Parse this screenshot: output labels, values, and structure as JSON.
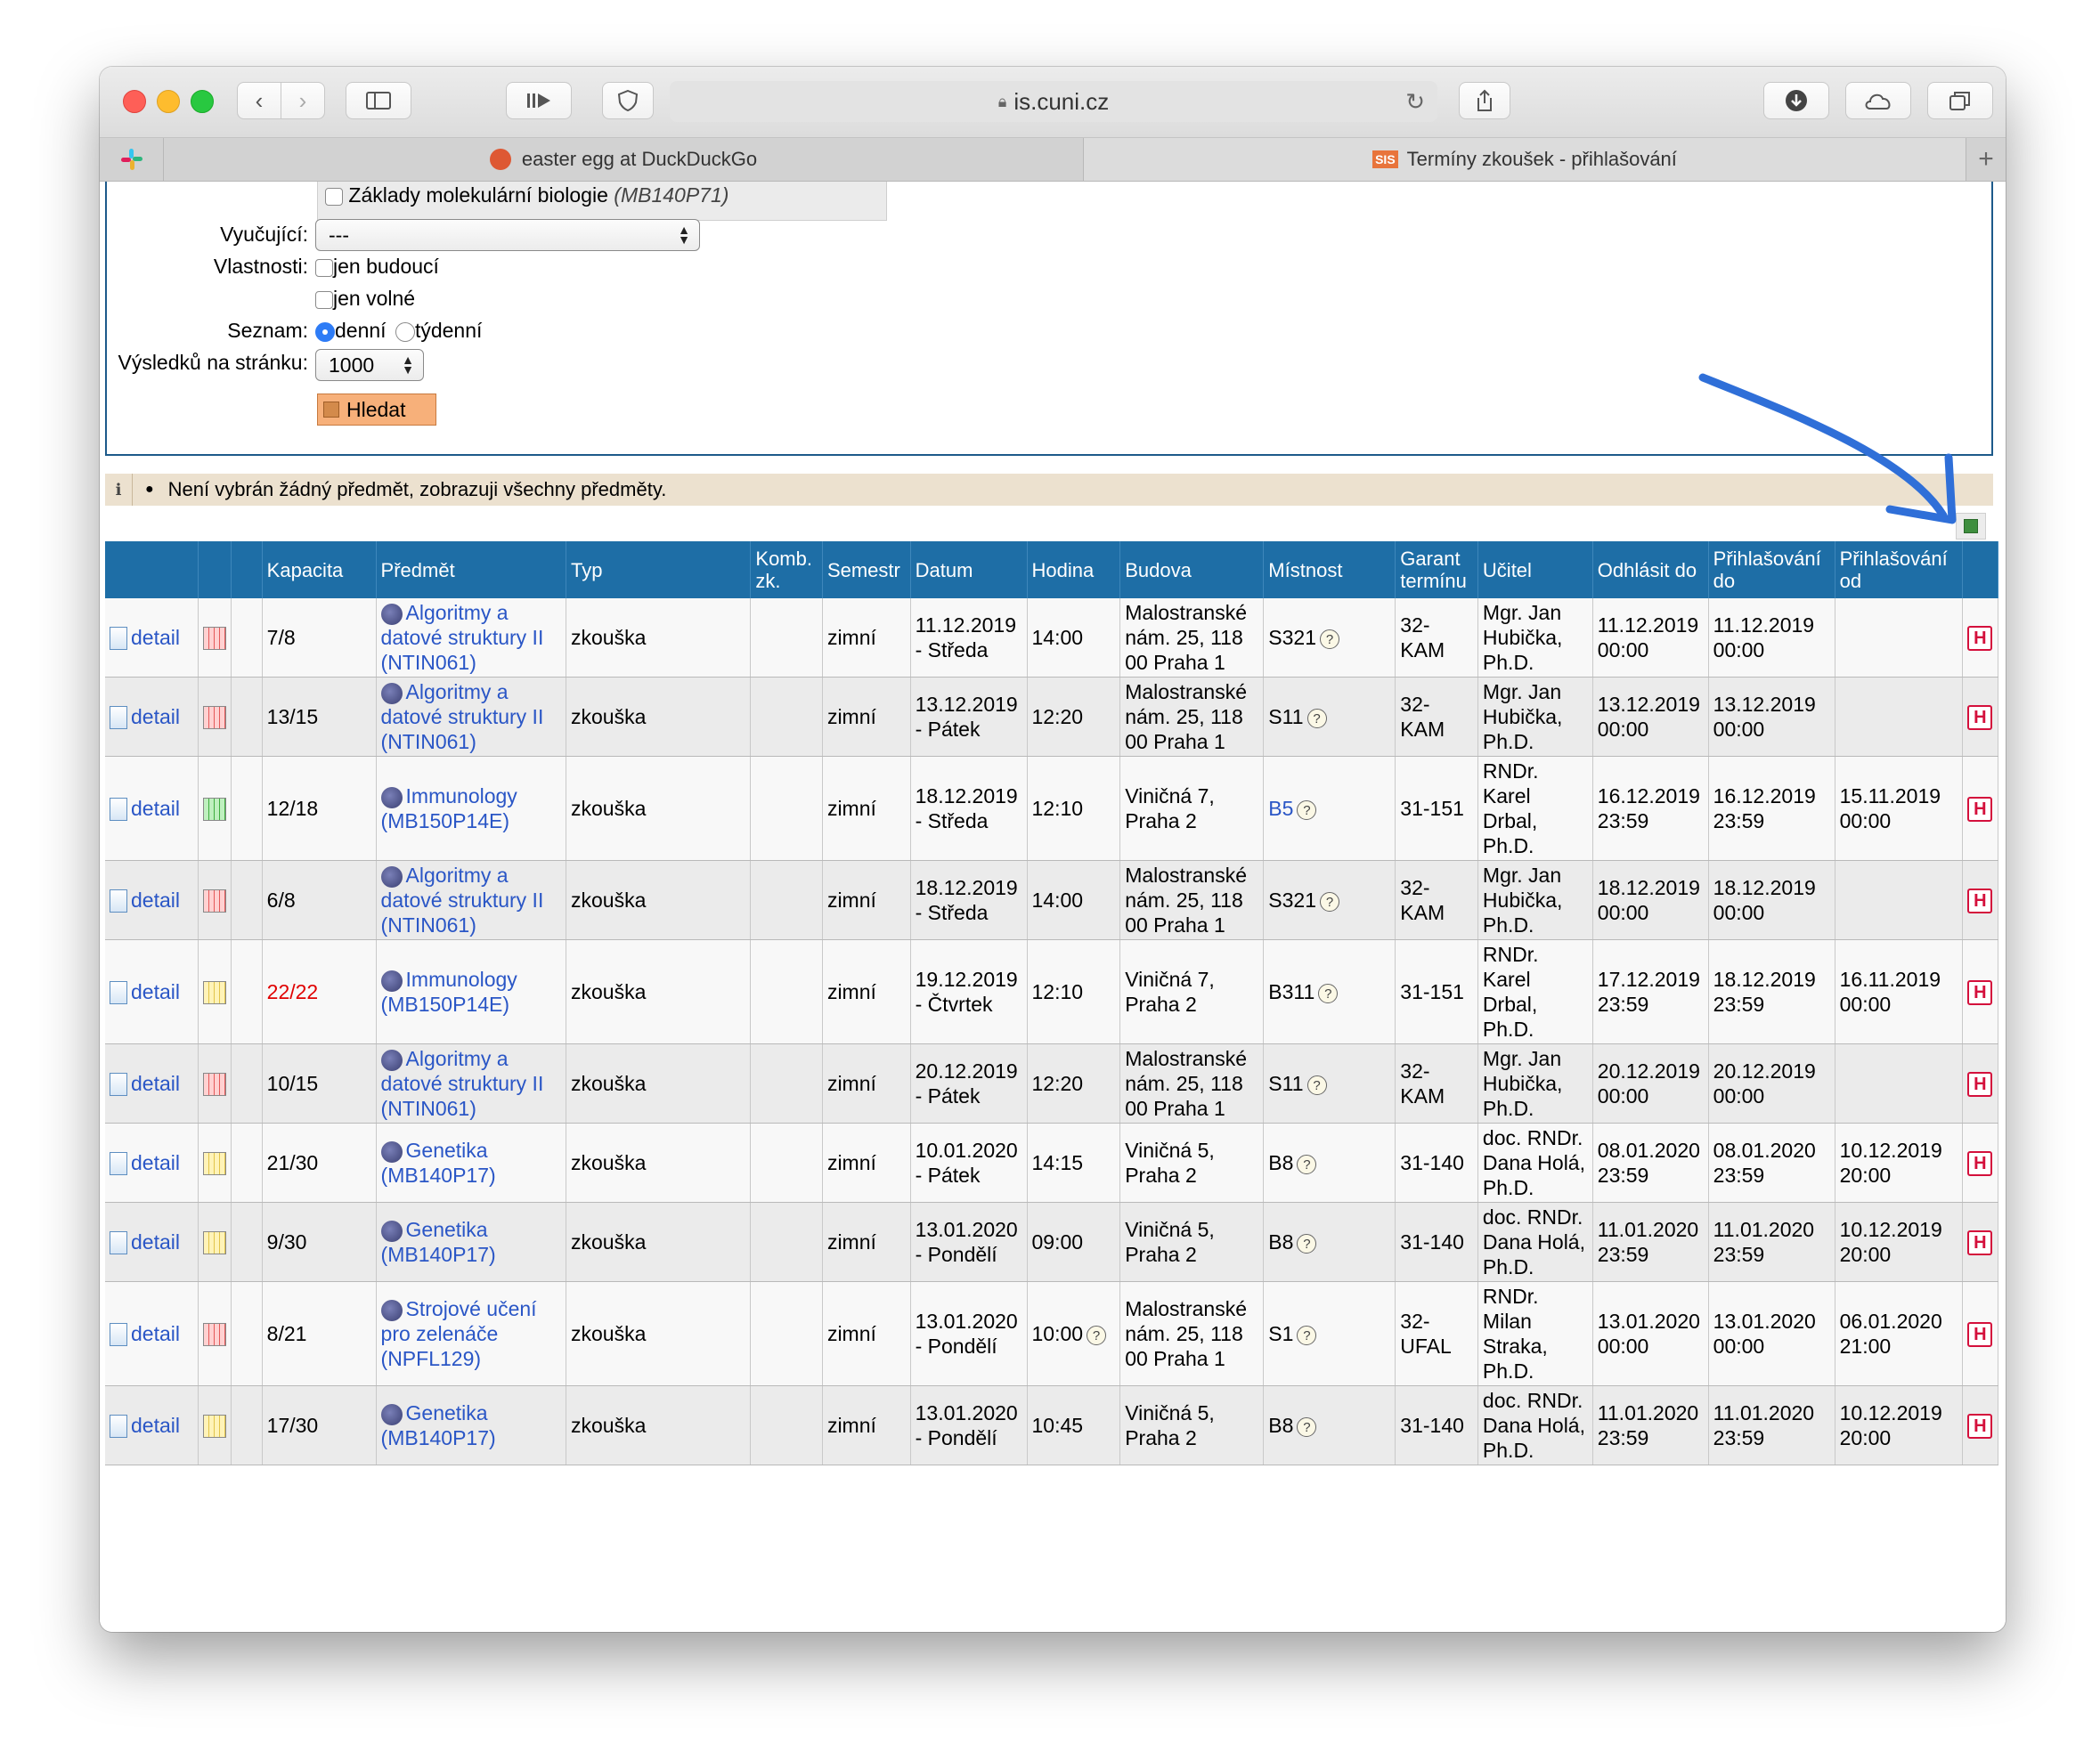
{
  "browser": {
    "url": "is.cuni.cz",
    "tabs": [
      {
        "title": "easter egg at DuckDuckGo"
      },
      {
        "title": "Termíny zkoušek - přihlašování",
        "badge": "SIS"
      }
    ]
  },
  "form": {
    "course_option": "Základy molekulární biologie",
    "course_option_code": "(MB140P71)",
    "teacher_label": "Vyučující:",
    "teacher_value": "---",
    "props_label": "Vlastnosti:",
    "prop_future": "jen budoucí",
    "prop_free": "jen volné",
    "list_label": "Seznam:",
    "list_daily": "denní",
    "list_weekly": "týdenní",
    "per_page_label": "Výsledků na stránku:",
    "per_page_value": "1000",
    "search_button": "Hledat"
  },
  "notice": {
    "bullet": "●",
    "text": "Není vybrán žádný předmět, zobrazuji všechny předměty."
  },
  "table": {
    "headers": {
      "kapacita": "Kapacita",
      "predmet": "Předmět",
      "typ": "Typ",
      "komb": "Komb. zk.",
      "semestr": "Semestr",
      "datum": "Datum",
      "hodina": "Hodina",
      "budova": "Budova",
      "mistnost": "Místnost",
      "garant": "Garant termínu",
      "ucitel": "Učitel",
      "odhlasit": "Odhlásit do",
      "prihl_do": "Přihlašování do",
      "prihl_od": "Přihlašování od"
    },
    "detail_label": "detail",
    "rows": [
      {
        "kapacita": "7/8",
        "full": false,
        "cal": "red",
        "predmet": "Algoritmy a datové struktury II (NTIN061)",
        "typ": "zkouška",
        "semestr": "zimní",
        "datum": "11.12.2019 - Středa",
        "hodina": "14:00",
        "budova": "Malostranské nám. 25, 118 00 Praha 1",
        "mistnost": "S321",
        "mistnost_link": false,
        "garant": "32-KAM",
        "ucitel": "Mgr. Jan Hubička, Ph.D.",
        "odhlasit": "11.12.2019 00:00",
        "prihl_do": "11.12.2019 00:00",
        "prihl_od": ""
      },
      {
        "kapacita": "13/15",
        "full": false,
        "cal": "red",
        "predmet": "Algoritmy a datové struktury II (NTIN061)",
        "typ": "zkouška",
        "semestr": "zimní",
        "datum": "13.12.2019 - Pátek",
        "hodina": "12:20",
        "budova": "Malostranské nám. 25, 118 00 Praha 1",
        "mistnost": "S11",
        "mistnost_link": false,
        "garant": "32-KAM",
        "ucitel": "Mgr. Jan Hubička, Ph.D.",
        "odhlasit": "13.12.2019 00:00",
        "prihl_do": "13.12.2019 00:00",
        "prihl_od": ""
      },
      {
        "kapacita": "12/18",
        "full": false,
        "cal": "green",
        "predmet": "Immunology (MB150P14E)",
        "typ": "zkouška",
        "semestr": "zimní",
        "datum": "18.12.2019 - Středa",
        "hodina": "12:10",
        "budova": "Viničná 7, Praha 2",
        "mistnost": "B5",
        "mistnost_link": true,
        "garant": "31-151",
        "ucitel": "RNDr. Karel Drbal, Ph.D.",
        "odhlasit": "16.12.2019 23:59",
        "prihl_do": "16.12.2019 23:59",
        "prihl_od": "15.11.2019 00:00"
      },
      {
        "kapacita": "6/8",
        "full": false,
        "cal": "red",
        "predmet": "Algoritmy a datové struktury II (NTIN061)",
        "typ": "zkouška",
        "semestr": "zimní",
        "datum": "18.12.2019 - Středa",
        "hodina": "14:00",
        "budova": "Malostranské nám. 25, 118 00 Praha 1",
        "mistnost": "S321",
        "mistnost_link": false,
        "garant": "32-KAM",
        "ucitel": "Mgr. Jan Hubička, Ph.D.",
        "odhlasit": "18.12.2019 00:00",
        "prihl_do": "18.12.2019 00:00",
        "prihl_od": ""
      },
      {
        "kapacita": "22/22",
        "full": true,
        "cal": "yellow",
        "predmet": "Immunology (MB150P14E)",
        "typ": "zkouška",
        "semestr": "zimní",
        "datum": "19.12.2019 - Čtvrtek",
        "hodina": "12:10",
        "budova": "Viničná 7, Praha 2",
        "mistnost": "B311",
        "mistnost_link": false,
        "garant": "31-151",
        "ucitel": "RNDr. Karel Drbal, Ph.D.",
        "odhlasit": "17.12.2019 23:59",
        "prihl_do": "18.12.2019 23:59",
        "prihl_od": "16.11.2019 00:00"
      },
      {
        "kapacita": "10/15",
        "full": false,
        "cal": "red",
        "predmet": "Algoritmy a datové struktury II (NTIN061)",
        "typ": "zkouška",
        "semestr": "zimní",
        "datum": "20.12.2019 - Pátek",
        "hodina": "12:20",
        "budova": "Malostranské nám. 25, 118 00 Praha 1",
        "mistnost": "S11",
        "mistnost_link": false,
        "garant": "32-KAM",
        "ucitel": "Mgr. Jan Hubička, Ph.D.",
        "odhlasit": "20.12.2019 00:00",
        "prihl_do": "20.12.2019 00:00",
        "prihl_od": ""
      },
      {
        "kapacita": "21/30",
        "full": false,
        "cal": "yellow",
        "predmet": "Genetika (MB140P17)",
        "typ": "zkouška",
        "semestr": "zimní",
        "datum": "10.01.2020 - Pátek",
        "hodina": "14:15",
        "budova": "Viničná 5, Praha 2",
        "mistnost": "B8",
        "mistnost_link": false,
        "garant": "31-140",
        "ucitel": "doc. RNDr. Dana Holá, Ph.D.",
        "odhlasit": "08.01.2020 23:59",
        "prihl_do": "08.01.2020 23:59",
        "prihl_od": "10.12.2019 20:00"
      },
      {
        "kapacita": "9/30",
        "full": false,
        "cal": "yellow",
        "predmet": "Genetika (MB140P17)",
        "typ": "zkouška",
        "semestr": "zimní",
        "datum": "13.01.2020 - Pondělí",
        "hodina": "09:00",
        "budova": "Viničná 5, Praha 2",
        "mistnost": "B8",
        "mistnost_link": false,
        "garant": "31-140",
        "ucitel": "doc. RNDr. Dana Holá, Ph.D.",
        "odhlasit": "11.01.2020 23:59",
        "prihl_do": "11.01.2020 23:59",
        "prihl_od": "10.12.2019 20:00"
      },
      {
        "kapacita": "8/21",
        "full": false,
        "cal": "red",
        "predmet": "Strojové učení pro zelenáče (NPFL129)",
        "typ": "zkouška",
        "semestr": "zimní",
        "datum": "13.01.2020 - Pondělí",
        "hodina": "10:00",
        "hodina_info": true,
        "budova": "Malostranské nám. 25, 118 00 Praha 1",
        "mistnost": "S1",
        "mistnost_link": false,
        "garant": "32-UFAL",
        "ucitel": "RNDr. Milan Straka, Ph.D.",
        "odhlasit": "13.01.2020 00:00",
        "prihl_do": "13.01.2020 00:00",
        "prihl_od": "06.01.2020 21:00"
      },
      {
        "kapacita": "17/30",
        "full": false,
        "cal": "yellow",
        "predmet": "Genetika (MB140P17)",
        "typ": "zkouška",
        "semestr": "zimní",
        "datum": "13.01.2020 - Pondělí",
        "hodina": "10:45",
        "budova": "Viničná 5, Praha 2",
        "mistnost": "B8",
        "mistnost_link": false,
        "garant": "31-140",
        "ucitel": "doc. RNDr. Dana Holá, Ph.D.",
        "odhlasit": "11.01.2020 23:59",
        "prihl_do": "11.01.2020 23:59",
        "prihl_od": "10.12.2019 20:00"
      }
    ]
  },
  "annotation_color": "#2f6fd8"
}
